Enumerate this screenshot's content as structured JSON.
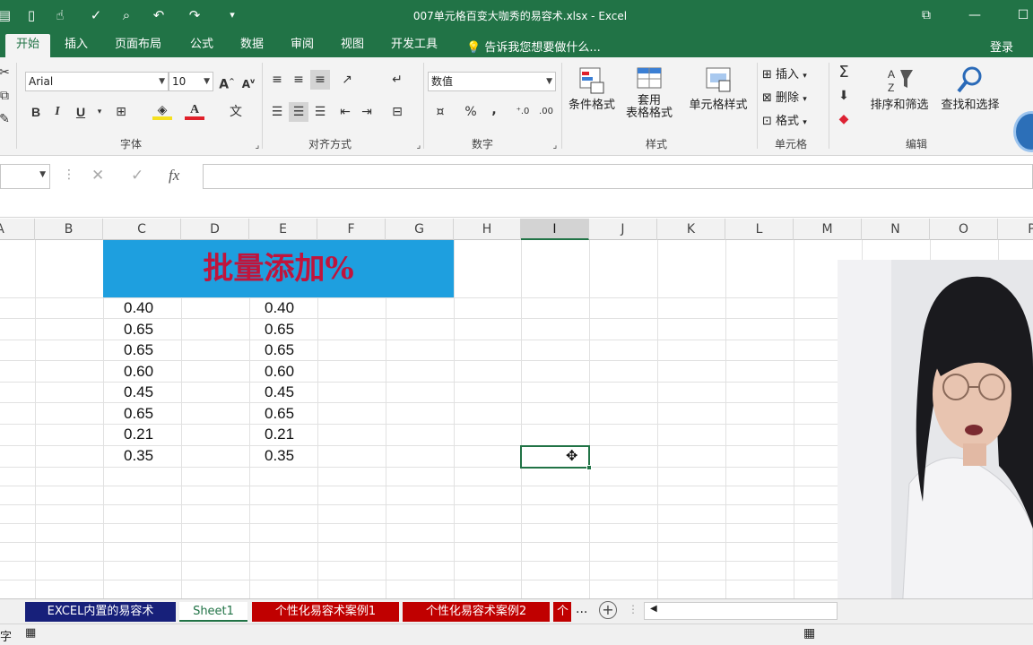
{
  "window": {
    "title": "007单元格百变大咖秀的易容术.xlsx - Excel"
  },
  "tabs": [
    {
      "label": "开始",
      "active": true
    },
    {
      "label": "插入"
    },
    {
      "label": "页面布局"
    },
    {
      "label": "公式"
    },
    {
      "label": "数据"
    },
    {
      "label": "审阅"
    },
    {
      "label": "视图"
    },
    {
      "label": "开发工具"
    }
  ],
  "tell_me": "告诉我您想要做什么...",
  "login": "登录",
  "ribbon": {
    "font": {
      "name": "Arial",
      "size": "10",
      "group_label": "字体",
      "bold": "B",
      "italic": "I",
      "underline": "U"
    },
    "alignment": {
      "group_label": "对齐方式"
    },
    "number": {
      "format": "数值",
      "group_label": "数字",
      "percent": "%",
      "comma": ","
    },
    "styles": {
      "conditional": "条件格式",
      "table_line1": "套用",
      "table_line2": "表格格式",
      "cell_styles": "单元格样式",
      "group_label": "样式"
    },
    "cells": {
      "insert": "插入",
      "delete": "删除",
      "format": "格式",
      "group_label": "单元格"
    },
    "editing": {
      "sort_filter": "排序和筛选",
      "find_select": "查找和选择",
      "group_label": "编辑"
    }
  },
  "formula_bar": {
    "cancel": "✕",
    "enter": "✓",
    "fx": "fx"
  },
  "columns": [
    "A",
    "B",
    "C",
    "D",
    "E",
    "F",
    "G",
    "H",
    "I",
    "J",
    "K",
    "L",
    "M",
    "N",
    "O",
    "P"
  ],
  "selected_column": "I",
  "sheet": {
    "banner": "批量添加%",
    "col_c": [
      "0.40",
      "0.65",
      "0.65",
      "0.60",
      "0.45",
      "0.65",
      "0.21",
      "0.35"
    ],
    "col_e": [
      "0.40",
      "0.65",
      "0.65",
      "0.60",
      "0.45",
      "0.65",
      "0.21",
      "0.35"
    ]
  },
  "sheet_tabs": [
    {
      "label": "EXCEL内置的易容术",
      "color": "#17207a"
    },
    {
      "label": "Sheet1",
      "active": true
    },
    {
      "label": "个性化易容术案例1",
      "color": "#c00000"
    },
    {
      "label": "个性化易容术案例2",
      "color": "#c00000"
    },
    {
      "label": "个",
      "color": "#c00000"
    }
  ],
  "sheet_more": "...",
  "status": {
    "mode": "字"
  },
  "colors": {
    "excel_green": "#217346",
    "banner_bg": "#1e9fdf",
    "banner_text": "#c0143c"
  }
}
